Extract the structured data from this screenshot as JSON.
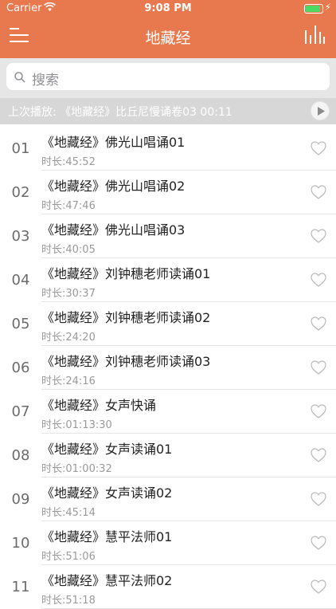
{
  "status": {
    "carrier": "Carrier",
    "time": "9:08 PM"
  },
  "nav": {
    "title": "地藏经"
  },
  "search": {
    "placeholder": "搜索"
  },
  "last_played": {
    "text": "上次播放: 《地藏经》比丘尼慢诵卷03  00:11"
  },
  "colors": {
    "accent": "#e8794e",
    "search_bg": "#e6e6e6",
    "banner_bg": "#d7d7d7"
  },
  "items": [
    {
      "num": "01",
      "name": "《地藏经》佛光山唱诵01",
      "duration": "时长:45:52"
    },
    {
      "num": "02",
      "name": "《地藏经》佛光山唱诵02",
      "duration": "时长:47:46"
    },
    {
      "num": "03",
      "name": "《地藏经》佛光山唱诵03",
      "duration": "时长:40:05"
    },
    {
      "num": "04",
      "name": "《地藏经》刘钟穗老师读诵01",
      "duration": "时长:30:37"
    },
    {
      "num": "05",
      "name": "《地藏经》刘钟穗老师读诵02",
      "duration": "时长:24:20"
    },
    {
      "num": "06",
      "name": "《地藏经》刘钟穗老师读诵03",
      "duration": "时长:24:16"
    },
    {
      "num": "07",
      "name": "《地藏经》女声快诵",
      "duration": "时长:01:13:30"
    },
    {
      "num": "08",
      "name": "《地藏经》女声读诵01",
      "duration": "时长:01:00:32"
    },
    {
      "num": "09",
      "name": "《地藏经》女声读诵02",
      "duration": "时长:45:14"
    },
    {
      "num": "10",
      "name": "《地藏经》慧平法师01",
      "duration": "时长:51:06"
    },
    {
      "num": "11",
      "name": "《地藏经》慧平法师02",
      "duration": "时长:51:18"
    }
  ]
}
